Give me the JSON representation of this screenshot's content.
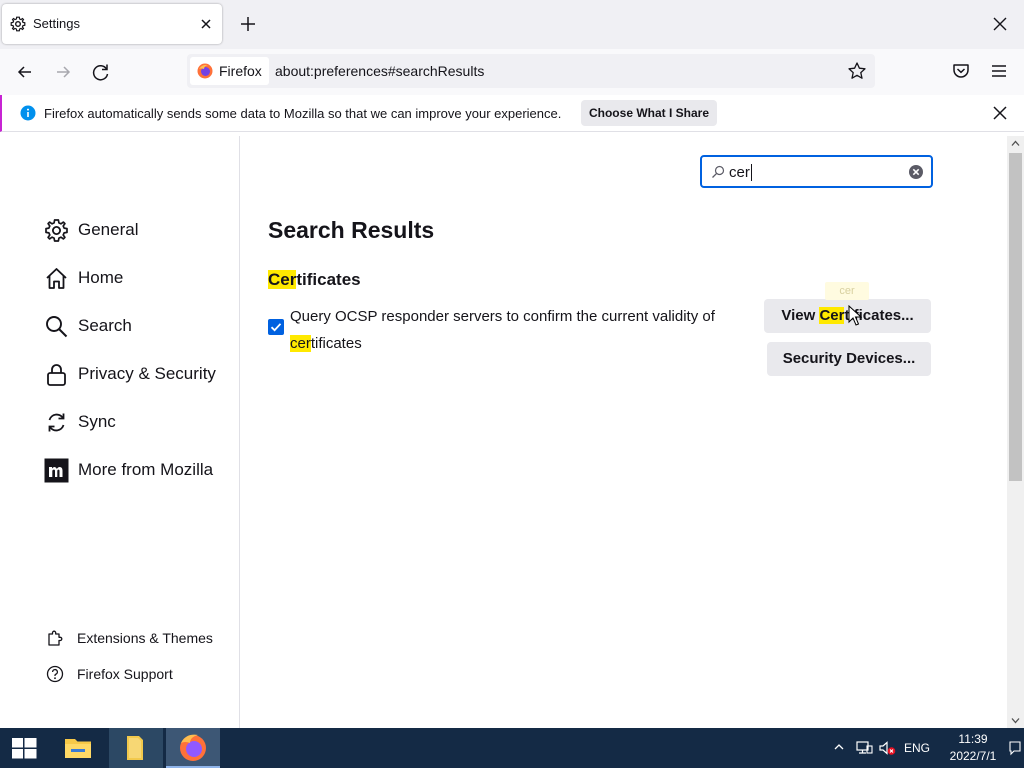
{
  "tab": {
    "title": "Settings",
    "icon": "gear-icon"
  },
  "toolbar": {
    "identity_label": "Firefox",
    "url": "about:preferences#searchResults"
  },
  "notification": {
    "text": "Firefox automatically sends some data to Mozilla so that we can improve your experience.",
    "button": "Choose What I Share"
  },
  "sidebar": {
    "items": [
      {
        "label": "General",
        "icon": "gear-icon"
      },
      {
        "label": "Home",
        "icon": "home-icon"
      },
      {
        "label": "Search",
        "icon": "search-icon"
      },
      {
        "label": "Privacy & Security",
        "icon": "lock-icon"
      },
      {
        "label": "Sync",
        "icon": "sync-icon"
      },
      {
        "label": "More from Mozilla",
        "icon": "mozilla-icon"
      }
    ],
    "footer": [
      {
        "label": "Extensions & Themes",
        "icon": "puzzle-icon"
      },
      {
        "label": "Firefox Support",
        "icon": "help-icon"
      }
    ]
  },
  "content": {
    "search_value": "cer",
    "results_title": "Search Results",
    "group_title_hl": "Cer",
    "group_title_rest": "tificates",
    "ocsp_label_before": "Query OCSP responder servers to confirm the current validity of ",
    "ocsp_label_hl": "cer",
    "ocsp_label_after": "tificates",
    "ocsp_checked": true,
    "view_certs_before": "View ",
    "view_certs_hl": "Cer",
    "view_certs_after": "tificates...",
    "security_devices": "Security Devices...",
    "tooltip_ghost": "cer"
  },
  "taskbar": {
    "lang": "ENG",
    "time": "11:39",
    "date": "2022/7/1"
  },
  "colors": {
    "accent": "#0061e0",
    "highlight": "#ffe900",
    "taskbar": "#142a45"
  }
}
